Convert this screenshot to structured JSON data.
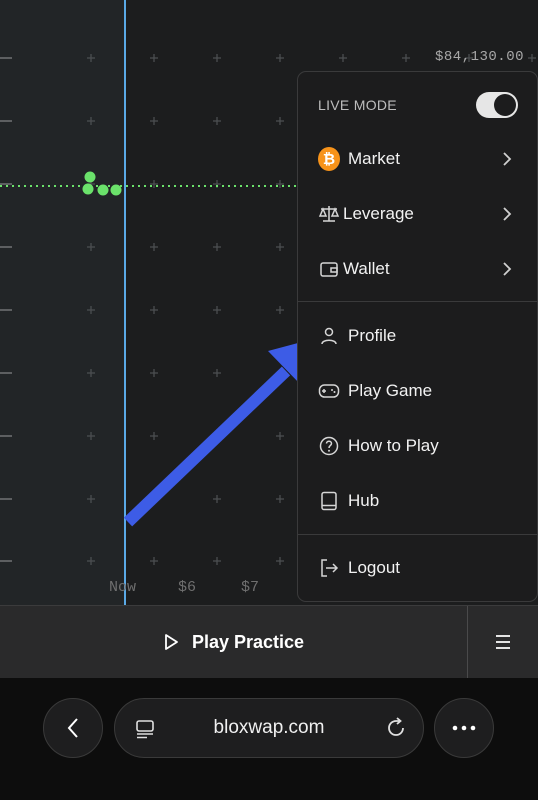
{
  "chart": {
    "price_label": "$84,130.00",
    "x_ticks": [
      "Now",
      "$6",
      "$7"
    ]
  },
  "menu": {
    "live_mode_label": "LIVE MODE",
    "live_mode_on": true,
    "items_top": [
      {
        "label": "Market",
        "icon": "bitcoin-icon"
      },
      {
        "label": "Leverage",
        "icon": "scale-icon"
      },
      {
        "label": "Wallet",
        "icon": "wallet-icon"
      }
    ],
    "items_mid": [
      {
        "label": "Profile",
        "icon": "user-icon"
      },
      {
        "label": "Play Game",
        "icon": "gamepad-icon"
      },
      {
        "label": "How to Play",
        "icon": "help-icon"
      },
      {
        "label": "Hub",
        "icon": "book-icon"
      }
    ],
    "logout_label": "Logout"
  },
  "bottom_bar": {
    "play_label": "Play Practice"
  },
  "browser": {
    "url": "bloxwap.com"
  },
  "colors": {
    "accent_blue": "#3d5ce6",
    "now_line": "#5aa9e6",
    "price_line": "#6be26b"
  }
}
